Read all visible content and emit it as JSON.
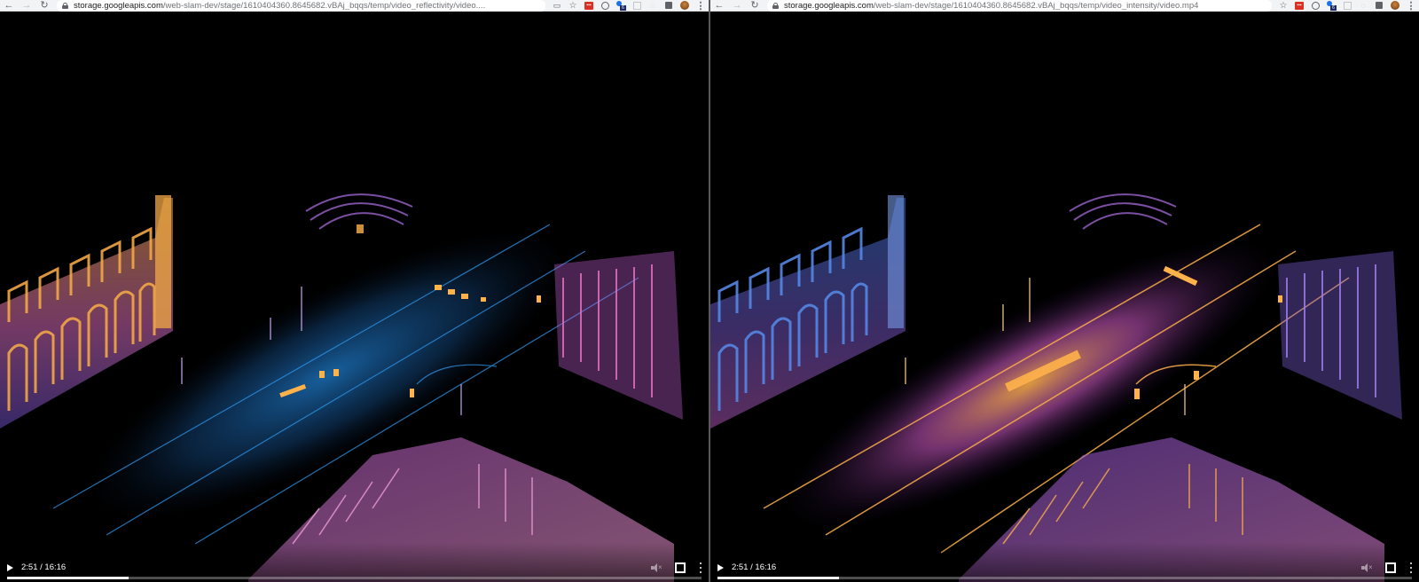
{
  "windows": [
    {
      "address": {
        "host": "storage.googleapis.com",
        "path": "/web-slam-dev/stage/1610404360.8645682.vBAj_bqqs/temp/video_reflectivity/video...."
      },
      "video": {
        "time": "2:51 / 16:16",
        "progress": 0.175,
        "palette": "reflectivity"
      }
    },
    {
      "address": {
        "host": "storage.googleapis.com",
        "path": "/web-slam-dev/stage/1610404360.8645682.vBAj_bqqs/temp/video_intensity/video.mp4"
      },
      "video": {
        "time": "2:51 / 16:16",
        "progress": 0.175,
        "palette": "intensity"
      }
    }
  ],
  "colors": {
    "toolbar_bg": "#f1f3f4",
    "lidar_blue": "#1f7fd1",
    "lidar_orange": "#ffb14a",
    "lidar_magenta": "#d05ac8",
    "lidar_purple": "#6b4fc8"
  },
  "icons": {
    "back": "arrow-left-icon",
    "forward": "arrow-right-icon",
    "reload": "reload-icon",
    "secure": "lock-icon",
    "bookmark": "star-icon",
    "extensions": "puzzle-icon",
    "menu": "kebab-menu-icon",
    "play": "play-icon",
    "mute": "volume-muted-icon",
    "fullscreen": "fullscreen-icon"
  }
}
